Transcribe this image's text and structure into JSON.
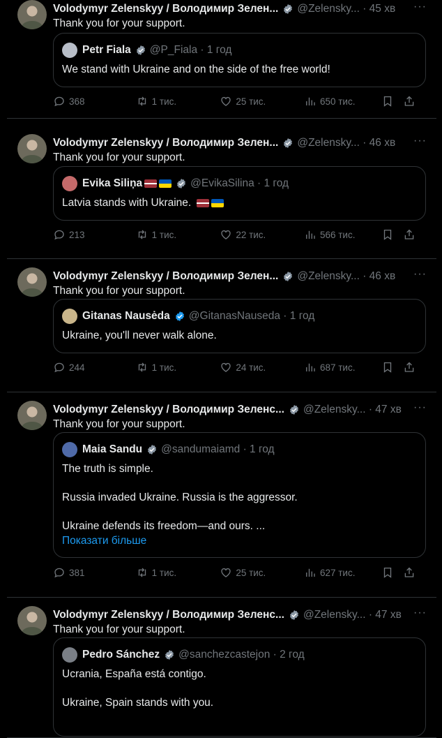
{
  "tweets": [
    {
      "author_name": "Volodymyr Zelenskyy / Володимир Зелен...",
      "handle": "@Zelensky...",
      "time": "· 45 хв",
      "text": "Thank you for your support.",
      "quote": {
        "name": "Petr Fiala",
        "flags": [],
        "handle": "@P_Fiala",
        "time": "· 1 год",
        "text": "We stand with Ukraine and on the side of the free world!"
      },
      "stats": {
        "replies": "368",
        "reposts": "1 тис.",
        "likes": "25 тис.",
        "views": "650 тис."
      }
    },
    {
      "author_name": "Volodymyr Zelenskyy / Володимир Зелен...",
      "handle": "@Zelensky...",
      "time": "· 46 хв",
      "text": "Thank you for your support.",
      "quote": {
        "name": "Evika Siliņa",
        "flags": [
          "lv",
          "ua"
        ],
        "handle": "@EvikaSilina",
        "time": "· 1 год",
        "text": "Latvia stands with Ukraine."
      },
      "stats": {
        "replies": "213",
        "reposts": "1 тис.",
        "likes": "22 тис.",
        "views": "566 тис."
      }
    },
    {
      "author_name": "Volodymyr Zelenskyy / Володимир Зелен...",
      "handle": "@Zelensky...",
      "time": "· 46 хв",
      "text": "Thank you for your support.",
      "quote": {
        "name": "Gitanas Nausėda",
        "flags": [],
        "handle": "@GitanasNauseda",
        "time": "· 1 год",
        "text": "Ukraine, you'll never walk alone."
      },
      "stats": {
        "replies": "244",
        "reposts": "1 тис.",
        "likes": "24 тис.",
        "views": "687 тис."
      }
    },
    {
      "author_name": "Volodymyr Zelenskyy / Володимир Зеленс...",
      "handle": "@Zelensky...",
      "time": "· 47 хв",
      "text": "Thank you for your support.",
      "quote": {
        "name": "Maia Sandu",
        "flags": [],
        "handle": "@sandumaiamd",
        "time": "· 1 год",
        "text": "The truth is simple.\n\nRussia invaded Ukraine. Russia is the aggressor.\n\nUkraine defends its freedom—and ours. ...",
        "show_more": "Показати більше"
      },
      "stats": {
        "replies": "381",
        "reposts": "1 тис.",
        "likes": "25 тис.",
        "views": "627 тис."
      }
    },
    {
      "author_name": "Volodymyr Zelenskyy / Володимир Зеленс...",
      "handle": "@Zelensky...",
      "time": "· 47 хв",
      "text": "Thank you for your support.",
      "quote": {
        "name": "Pedro Sánchez",
        "flags": [],
        "handle": "@sanchezcastejon",
        "time": "· 2 год",
        "text": "Ucrania, España está contigo.\n\nUkraine, Spain stands with you."
      }
    }
  ]
}
